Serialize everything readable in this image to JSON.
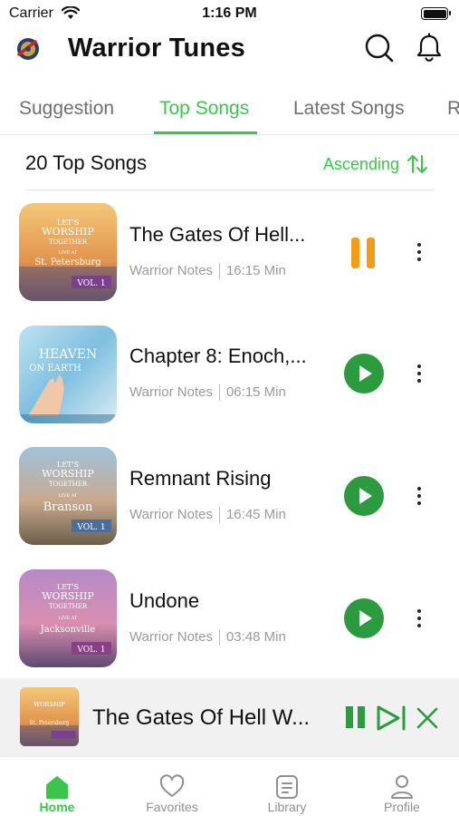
{
  "status": {
    "carrier": "Carrier",
    "time": "1:16 PM",
    "battery_level": 1.0
  },
  "header": {
    "title": "Warrior Tunes"
  },
  "tabs": [
    {
      "label": "Suggestion",
      "active": false
    },
    {
      "label": "Top Songs",
      "active": true
    },
    {
      "label": "Latest Songs",
      "active": false
    },
    {
      "label": "R",
      "active": false
    }
  ],
  "section": {
    "title": "20 Top Songs",
    "sort_label": "Ascending"
  },
  "songs": [
    {
      "title": "The Gates Of Hell...",
      "artist": "Warrior Notes",
      "duration": "16:15 Min",
      "state": "pause",
      "cover": {
        "line1": "LET'S",
        "line2": "WORSHIP",
        "line3": "TOGETHER",
        "line4": "LIVE AT",
        "place": "St. Petersburg",
        "vol": "VOL. 1"
      }
    },
    {
      "title": "Chapter 8: Enoch,...",
      "artist": "Warrior Notes",
      "duration": "06:15 Min",
      "state": "play",
      "cover": {
        "line1": "HEAVEN",
        "line2": "ON EARTH"
      }
    },
    {
      "title": "Remnant Rising",
      "artist": "Warrior Notes",
      "duration": "16:45 Min",
      "state": "play",
      "cover": {
        "line1": "LET'S",
        "line2": "WORSHIP",
        "line3": "TOGETHER",
        "line4": "LIVE AT",
        "place": "Branson",
        "vol": "VOL. 1"
      }
    },
    {
      "title": "Undone",
      "artist": "Warrior Notes",
      "duration": "03:48 Min",
      "state": "play",
      "cover": {
        "line1": "LET'S",
        "line2": "WORSHIP",
        "line3": "TOGETHER",
        "line4": "LIVE AT",
        "place": "Jacksonville",
        "vol": "VOL. 1"
      }
    }
  ],
  "mini_player": {
    "title": "The Gates Of Hell W..."
  },
  "nav": [
    {
      "label": "Home",
      "icon": "home-icon",
      "active": true
    },
    {
      "label": "Favorites",
      "icon": "heart-icon",
      "active": false
    },
    {
      "label": "Library",
      "icon": "library-icon",
      "active": false
    },
    {
      "label": "Profile",
      "icon": "profile-icon",
      "active": false
    }
  ],
  "colors": {
    "accent": "#3cc54c",
    "play": "#2c9a3e",
    "pause": "#f59b1a"
  }
}
